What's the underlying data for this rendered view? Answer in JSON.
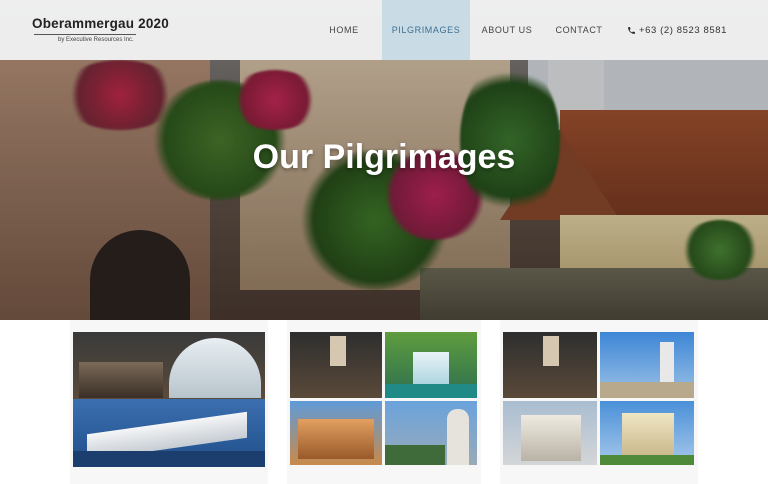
{
  "brand": {
    "title": "Oberammergau 2020",
    "subtitle": "by Executive Resources Inc."
  },
  "nav": {
    "items": [
      {
        "label": "HOME",
        "active": false
      },
      {
        "label": "PILGRIMAGES",
        "active": true
      },
      {
        "label": "ABOUT US",
        "active": false
      },
      {
        "label": "CONTACT",
        "active": false
      }
    ],
    "phone": "+63 (2) 8523 8581",
    "phone_icon": "phone-icon"
  },
  "hero": {
    "title": "Our Pilgrimages"
  },
  "colors": {
    "nav_active_bg": "#c9dce6",
    "nav_active_text": "#3f6f8e",
    "nav_bg": "#f5f5f5"
  },
  "cards": [
    {
      "name": "package-card-1",
      "images": [
        "passion-play-stage",
        "river-cruise-ship"
      ]
    },
    {
      "name": "package-card-2",
      "images": [
        "passion-play-stage",
        "waterfall-lakes",
        "town-hall-square",
        "statue-of-pope"
      ]
    },
    {
      "name": "package-card-3",
      "images": [
        "passion-play-stage",
        "church-twin-spires",
        "cathedral-facade",
        "baroque-basilica"
      ]
    }
  ]
}
